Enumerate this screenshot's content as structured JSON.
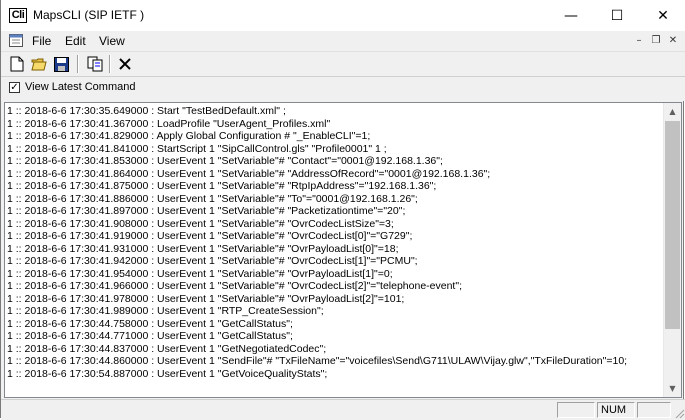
{
  "window": {
    "app_icon_text": "Cli",
    "title": "MapsCLI  (SIP IETF )",
    "minimize_glyph": "—",
    "maximize_glyph": "☐",
    "close_glyph": "✕"
  },
  "menu": {
    "items": [
      "File",
      "Edit",
      "View"
    ],
    "mdi_minimize": "–",
    "mdi_restore": "❐",
    "mdi_close": "✕"
  },
  "toolbar": {
    "buttons": [
      "new-file-icon",
      "open-folder-icon",
      "save-icon",
      "copy-icon",
      "cut-icon"
    ]
  },
  "view_latest": {
    "label": "View Latest Command",
    "checked": true,
    "check_glyph": "✓"
  },
  "log": {
    "lines": [
      "1 :: 2018-6-6 17:30:35.649000 : Start \"TestBedDefault.xml\" ;",
      "1 :: 2018-6-6 17:30:41.367000 : LoadProfile \"UserAgent_Profiles.xml\"",
      "1 :: 2018-6-6 17:30:41.829000 : Apply Global Configuration # \"_EnableCLI\"=1;",
      "1 :: 2018-6-6 17:30:41.841000 : StartScript 1 \"SipCallControl.gls\" \"Profile0001\" 1 ;",
      "1 :: 2018-6-6 17:30:41.853000 : UserEvent 1 \"SetVariable\"# \"Contact\"=\"0001@192.168.1.36\";",
      "1 :: 2018-6-6 17:30:41.864000 : UserEvent 1 \"SetVariable\"# \"AddressOfRecord\"=\"0001@192.168.1.36\";",
      "1 :: 2018-6-6 17:30:41.875000 : UserEvent 1 \"SetVariable\"# \"RtpIpAddress\"=\"192.168.1.36\";",
      "1 :: 2018-6-6 17:30:41.886000 : UserEvent 1 \"SetVariable\"# \"To\"=\"0001@192.168.1.26\";",
      "1 :: 2018-6-6 17:30:41.897000 : UserEvent 1 \"SetVariable\"# \"Packetizationtime\"=\"20\";",
      "1 :: 2018-6-6 17:30:41.908000 : UserEvent 1 \"SetVariable\"# \"OvrCodecListSize\"=3;",
      "1 :: 2018-6-6 17:30:41.919000 : UserEvent 1 \"SetVariable\"# \"OvrCodecList[0]\"=\"G729\";",
      "1 :: 2018-6-6 17:30:41.931000 : UserEvent 1 \"SetVariable\"# \"OvrPayloadList[0]\"=18;",
      "1 :: 2018-6-6 17:30:41.942000 : UserEvent 1 \"SetVariable\"# \"OvrCodecList[1]\"=\"PCMU\";",
      "1 :: 2018-6-6 17:30:41.954000 : UserEvent 1 \"SetVariable\"# \"OvrPayloadList[1]\"=0;",
      "1 :: 2018-6-6 17:30:41.966000 : UserEvent 1 \"SetVariable\"# \"OvrCodecList[2]\"=\"telephone-event\";",
      "1 :: 2018-6-6 17:30:41.978000 : UserEvent 1 \"SetVariable\"# \"OvrPayloadList[2]\"=101;",
      "1 :: 2018-6-6 17:30:41.989000 : UserEvent 1 \"RTP_CreateSession\";",
      "1 :: 2018-6-6 17:30:44.758000 : UserEvent 1 \"GetCallStatus\";",
      "1 :: 2018-6-6 17:30:44.771000 : UserEvent 1 \"GetCallStatus\";",
      "1 :: 2018-6-6 17:30:44.837000 : UserEvent 1 \"GetNegotiatedCodec\";",
      "1 :: 2018-6-6 17:30:44.860000 : UserEvent 1 \"SendFile\"# \"TxFileName\"=\"voicefiles\\Send\\G711\\ULAW\\Vijay.glw\",\"TxFileDuration\"=10;",
      "1 :: 2018-6-6 17:30:54.887000 : UserEvent 1 \"GetVoiceQualityStats\";"
    ],
    "scroll_up_glyph": "▲",
    "scroll_down_glyph": "▼"
  },
  "status": {
    "num_lock": "NUM"
  }
}
